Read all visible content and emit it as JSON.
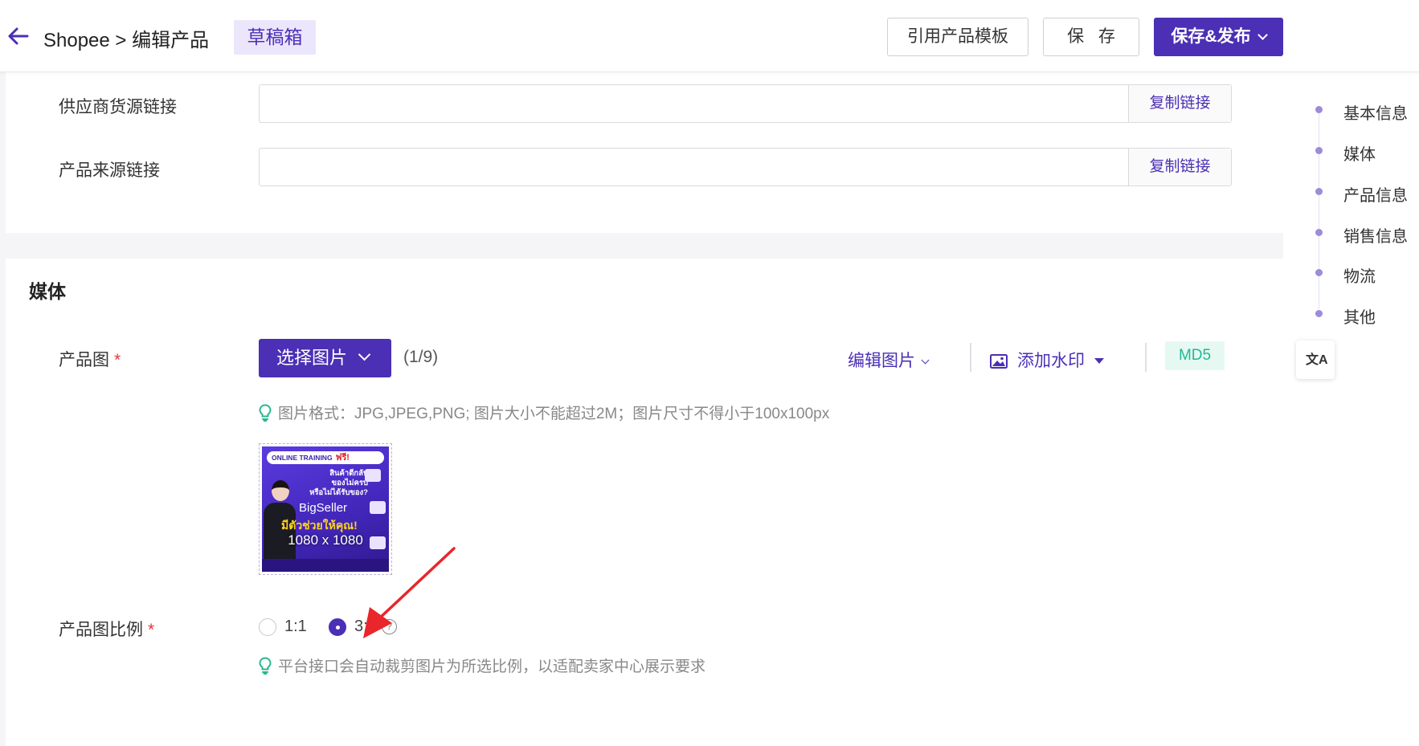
{
  "header": {
    "breadcrumb": "Shopee > 编辑产品",
    "draft_badge": "草稿箱",
    "template_button": "引用产品模板",
    "save_button": "保 存",
    "publish_button": "保存&发布"
  },
  "links": {
    "supplier_label": "供应商货源链接",
    "source_label": "产品来源链接",
    "supplier_value": "",
    "source_value": "",
    "copy_label": "复制链接"
  },
  "media": {
    "section_title": "媒体",
    "product_image_label": "产品图",
    "required_mark": "*",
    "select_button": "选择图片",
    "image_count": "(1/9)",
    "edit_image": "编辑图片",
    "add_watermark": "添加水印",
    "md5": "MD5",
    "format_tip": "图片格式：JPG,JPEG,PNG; 图片大小不能超过2M；图片尺寸不得小于100x100px",
    "thumbnail": {
      "size": "1080 x 1080",
      "banner_text": "ONLINE TRAINING",
      "banner_free": "ฟรี!",
      "thai_lines": [
        "สินค้าตีกลับ",
        "ของไม่ครบ",
        "หรือไม่ได้รับของ?"
      ],
      "logo": "BigSeller",
      "cta": "มีตัวช่วยให้คุณ!"
    },
    "ratio_label": "产品图比例",
    "ratio_options": [
      "1:1",
      "3:4"
    ],
    "ratio_selected": "3:4",
    "ratio_tip": "平台接口会自动裁剪图片为所选比例，以适配卖家中心展示要求"
  },
  "rightnav": {
    "items": [
      "基本信息",
      "媒体",
      "产品信息",
      "销售信息",
      "物流",
      "其他"
    ],
    "translate_icon": "translate-icon"
  },
  "colors": {
    "primary": "#4b2fb5",
    "draft_bg": "#ebe6fb",
    "md5_text": "#23b893",
    "required": "#e2363c",
    "arrow": "#e8262b"
  }
}
